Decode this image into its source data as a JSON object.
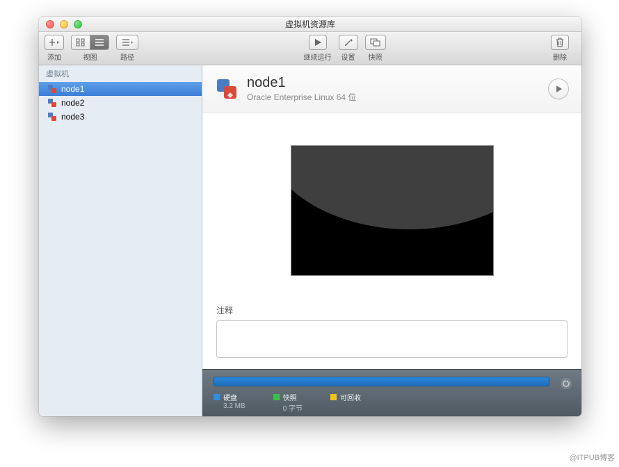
{
  "window": {
    "title": "虚拟机资源库"
  },
  "toolbar": {
    "add": "添加",
    "view": "视图",
    "path": "路径",
    "resume": "继续运行",
    "settings": "设置",
    "snapshot": "快照",
    "delete": "删除"
  },
  "sidebar": {
    "header": "虚拟机",
    "items": [
      {
        "label": "node1",
        "selected": true
      },
      {
        "label": "node2",
        "selected": false
      },
      {
        "label": "node3",
        "selected": false
      }
    ]
  },
  "vm": {
    "name": "node1",
    "os": "Oracle Enterprise Linux 64 位",
    "notes_label": "注释",
    "notes": ""
  },
  "footer": {
    "legend": [
      {
        "color": "blue",
        "label": "硬盘",
        "value": "3.2 MB"
      },
      {
        "color": "green",
        "label": "快照",
        "value": "0 字节"
      },
      {
        "color": "yellow",
        "label": "可回收",
        "value": ""
      }
    ]
  },
  "watermark": "@ITPUB博客"
}
